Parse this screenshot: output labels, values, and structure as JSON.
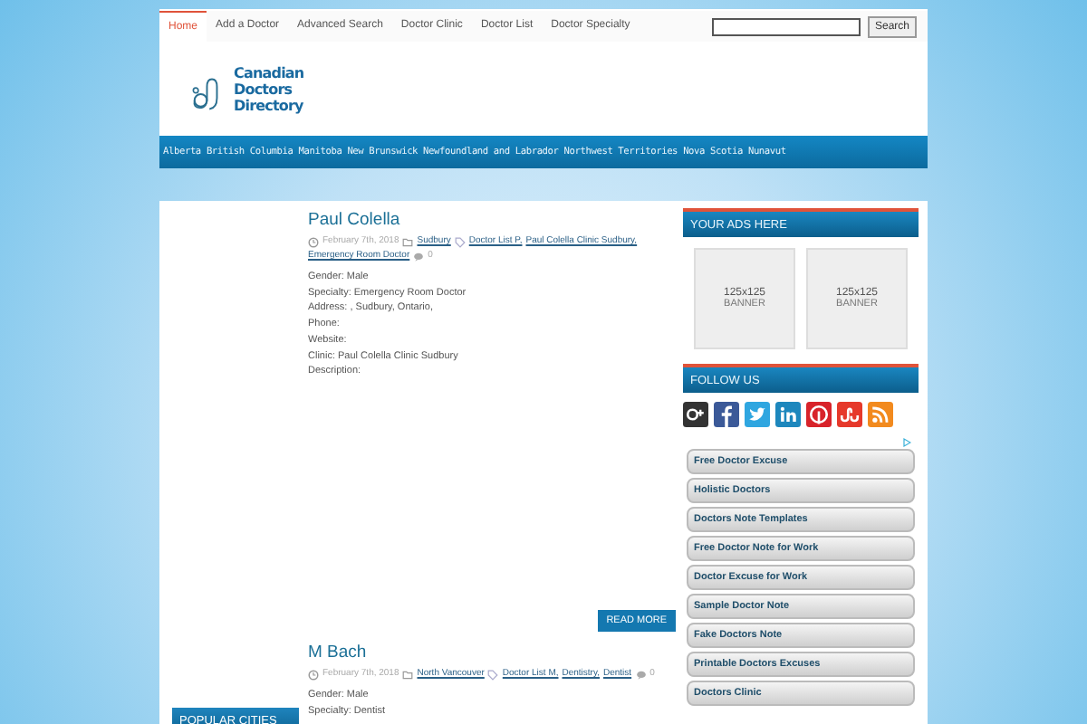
{
  "top_nav": {
    "items": [
      {
        "label": "Home",
        "selected": true
      },
      {
        "label": "Add a Doctor",
        "selected": false
      },
      {
        "label": "Advanced Search",
        "selected": false
      },
      {
        "label": "Doctor Clinic",
        "selected": false
      },
      {
        "label": "Doctor List",
        "selected": false
      },
      {
        "label": "Doctor Specialty",
        "selected": false
      }
    ],
    "search_button": "Search"
  },
  "logo": {
    "lines": [
      "Canadian",
      "Doctors",
      "Directory"
    ]
  },
  "province_nav": [
    "Alberta",
    "British Columbia",
    "Manitoba",
    "New Brunswick",
    "Newfoundland and Labrador",
    "Northwest Territories",
    "Nova Scotia",
    "Nunavut"
  ],
  "posts": [
    {
      "title": "Paul Colella",
      "date": "February 7th, 2018",
      "categories": [
        "Sudbury"
      ],
      "tags": [
        "Doctor List P,",
        "Paul Colella Clinic Sudbury,",
        "Emergency Room Doctor"
      ],
      "comments": "0",
      "lines": [
        "Gender: Male",
        "Specialty: Emergency Room Doctor",
        "Address: , Sudbury, Ontario,",
        "Phone:",
        "Website:",
        "Clinic: Paul Colella Clinic Sudbury",
        "Description:"
      ],
      "read_more": "READ MORE"
    },
    {
      "title": "M Bach",
      "date": "February 7th, 2018",
      "categories": [
        "North Vancouver"
      ],
      "tags": [
        "Doctor List M,",
        "Dentistry,",
        "Dentist"
      ],
      "comments": "0",
      "lines": [
        "Gender: Male",
        "Specialty: Dentist"
      ]
    }
  ],
  "left_sidebar": {
    "heading": "POPULAR CITIES"
  },
  "right_sidebar": {
    "ads_heading": "YOUR ADS HERE",
    "banners": [
      {
        "size": "125x125",
        "label": "BANNER"
      },
      {
        "size": "125x125",
        "label": "BANNER"
      }
    ],
    "follow_heading": "FOLLOW US",
    "ad_links": [
      "Free Doctor Excuse",
      "Holistic Doctors",
      "Doctors Note Templates",
      "Free Doctor Note for Work",
      "Doctor Excuse for Work",
      "Sample Doctor Note",
      "Fake Doctors Note",
      "Printable Doctors Excuses",
      "Doctors Clinic"
    ]
  }
}
